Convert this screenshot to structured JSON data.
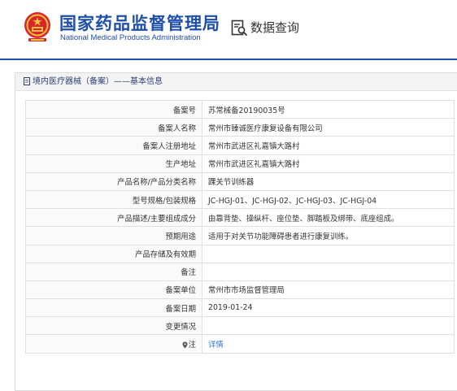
{
  "header": {
    "title": "国家药品监督管理局",
    "subtitle": "National Medical Products Administration",
    "search_label": "数据查询",
    "brand_color": "#1e4ea8"
  },
  "panel": {
    "heading": "境内医疗器械（备案）——基本信息"
  },
  "rows": [
    {
      "label": "备案号",
      "value": "苏常械备20190035号"
    },
    {
      "label": "备案人名称",
      "value": "常州市臻诚医疗康复设备有限公司"
    },
    {
      "label": "备案人注册地址",
      "value": "常州市武进区礼嘉镇大路村"
    },
    {
      "label": "生产地址",
      "value": "常州市武进区礼嘉镇大路村"
    },
    {
      "label": "产品名称/产品分类名称",
      "value": "踝关节训练器"
    },
    {
      "label": "型号规格/包装规格",
      "value": "JC-HGJ-01、JC-HGJ-02、JC-HGJ-03、JC-HGJ-04"
    },
    {
      "label": "产品描述/主要组成成分",
      "value": "由靠背垫、操纵杆、座位垫、脚踏板及绑带、底座组成。"
    },
    {
      "label": "预期用途",
      "value": "适用于对关节功能障碍患者进行康复训练。"
    },
    {
      "label": "产品存储及有效期",
      "value": ""
    },
    {
      "label": "备注",
      "value": ""
    },
    {
      "label": "备案单位",
      "value": "常州市市场监督管理局"
    },
    {
      "label": "备案日期",
      "value": "2019-01-24"
    },
    {
      "label": "变更情况",
      "value": ""
    },
    {
      "label": "注",
      "value": "详情"
    }
  ]
}
